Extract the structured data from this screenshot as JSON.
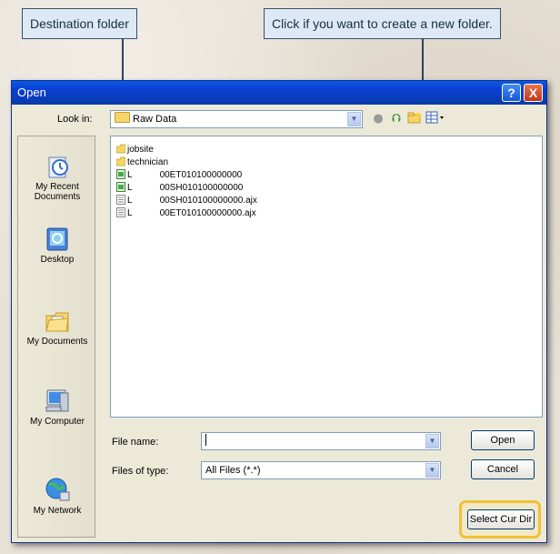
{
  "callouts": {
    "destination": "Destination folder",
    "new_folder": "Click if you want to create a new folder."
  },
  "dialog": {
    "title": "Open",
    "help_glyph": "?",
    "close_glyph": "X",
    "look_in_label": "Look in:",
    "look_in_value": "Raw Data",
    "toolbar_icons": [
      "back-icon",
      "up-folder-icon",
      "new-folder-icon",
      "views-menu-icon"
    ],
    "places": [
      {
        "label": "My Recent Documents",
        "icon": "recent-documents-icon"
      },
      {
        "label": "Desktop",
        "icon": "desktop-icon"
      },
      {
        "label": "My Documents",
        "icon": "my-documents-icon"
      },
      {
        "label": "My Computer",
        "icon": "my-computer-icon"
      },
      {
        "label": "My Network",
        "icon": "my-network-icon"
      }
    ],
    "files": [
      {
        "kind": "folder",
        "prefix": "",
        "name": "jobsite"
      },
      {
        "kind": "folder",
        "prefix": "",
        "name": "technician"
      },
      {
        "kind": "data",
        "prefix": "L",
        "name": "00ET010100000000"
      },
      {
        "kind": "data",
        "prefix": "L",
        "name": "00SH010100000000"
      },
      {
        "kind": "doc",
        "prefix": "L",
        "name": "00SH010100000000.ajx"
      },
      {
        "kind": "doc",
        "prefix": "L",
        "name": "00ET010100000000.ajx"
      }
    ],
    "file_name_label": "File name:",
    "file_name_value": "",
    "file_type_label": "Files of type:",
    "file_type_value": "All Files (*.*)",
    "buttons": {
      "open": "Open",
      "cancel": "Cancel",
      "select_cur_dir": "Select Cur Dir"
    }
  },
  "colors": {
    "titlebar": "#0b3fd4",
    "callout_bg": "#dde9f5",
    "highlight": "#f2c136"
  }
}
